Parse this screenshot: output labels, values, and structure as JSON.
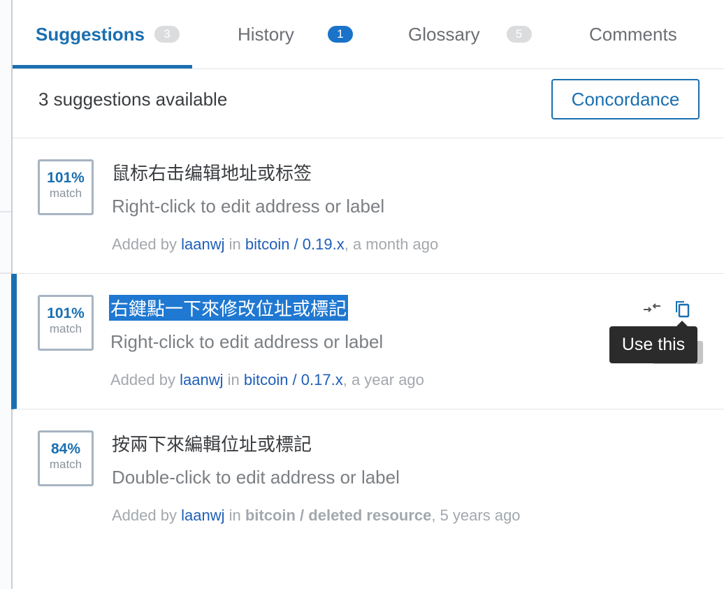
{
  "tabs": [
    {
      "label": "Suggestions",
      "count": "3"
    },
    {
      "label": "History",
      "count": "1"
    },
    {
      "label": "Glossary",
      "count": "5"
    },
    {
      "label": "Comments",
      "count": ""
    }
  ],
  "toolbar": {
    "count_text": "3 suggestions available",
    "concordance_label": "Concordance"
  },
  "suggestions": [
    {
      "match_pct": "101%",
      "match_label": "match",
      "translation": "鼠标右击编辑地址或标签",
      "source": "Right-click to edit address or label",
      "added_by": "Added by",
      "user": "laanwj",
      "in": "in",
      "project": "bitcoin / 0.19.x",
      "time": ", a month ago"
    },
    {
      "match_pct": "101%",
      "match_label": "match",
      "translation": "右鍵點一下來修改位址或標記",
      "source": "Right-click to edit address or label",
      "added_by": "Added by",
      "user": "laanwj",
      "in": "in",
      "project": "bitcoin / 0.17.x",
      "time": ", a year ago"
    },
    {
      "match_pct": "84%",
      "match_label": "match",
      "translation": "按兩下來編輯位址或標記",
      "source": "Double-click to edit address or label",
      "added_by": "Added by",
      "user": "laanwj",
      "in": "in",
      "project": "bitcoin / deleted resource",
      "time": ", 5 years ago"
    }
  ],
  "tooltip": "Use this",
  "icons": {
    "compare": "compare-arrows-icon",
    "copy": "copy-icon"
  },
  "colors": {
    "accent": "#1a6fb0",
    "badge_blue": "#1a73c9",
    "highlight": "#1f78d1"
  }
}
